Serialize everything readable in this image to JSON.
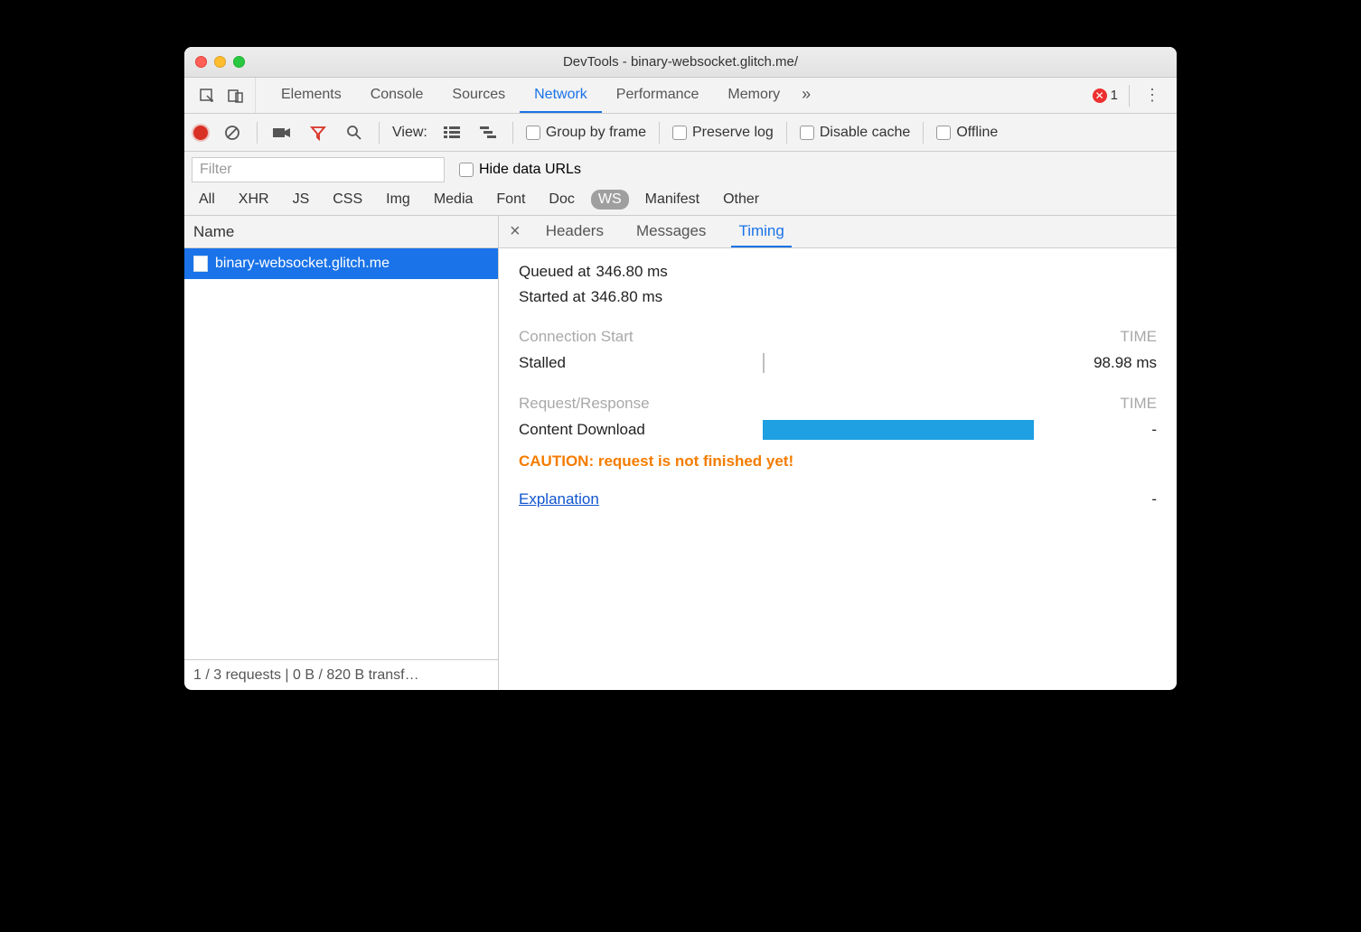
{
  "window": {
    "title": "DevTools - binary-websocket.glitch.me/"
  },
  "main_tabs": {
    "items": [
      "Elements",
      "Console",
      "Sources",
      "Network",
      "Performance",
      "Memory"
    ],
    "active_index": 3,
    "overflow": "»",
    "error_count": "1"
  },
  "toolbar": {
    "view_label": "View:",
    "group_by_frame": "Group by frame",
    "preserve_log": "Preserve log",
    "disable_cache": "Disable cache",
    "offline": "Offline"
  },
  "filter": {
    "placeholder": "Filter",
    "hide_data_urls": "Hide data URLs",
    "types": [
      "All",
      "XHR",
      "JS",
      "CSS",
      "Img",
      "Media",
      "Font",
      "Doc",
      "WS",
      "Manifest",
      "Other"
    ],
    "active_type_index": 8
  },
  "sidebar": {
    "header": "Name",
    "items": [
      "binary-websocket.glitch.me"
    ],
    "status": "1 / 3 requests | 0 B / 820 B transf…"
  },
  "detail": {
    "tabs": [
      "Headers",
      "Messages",
      "Timing"
    ],
    "active_index": 2,
    "timing": {
      "queued_label": "Queued at",
      "queued_value": "346.80 ms",
      "started_label": "Started at",
      "started_value": "346.80 ms",
      "connection_start_label": "Connection Start",
      "time_label": "TIME",
      "stalled_label": "Stalled",
      "stalled_value": "98.98 ms",
      "request_response_label": "Request/Response",
      "content_download_label": "Content Download",
      "content_download_value": "-",
      "caution": "CAUTION: request is not finished yet!",
      "explanation_label": "Explanation",
      "explanation_value": "-"
    }
  }
}
